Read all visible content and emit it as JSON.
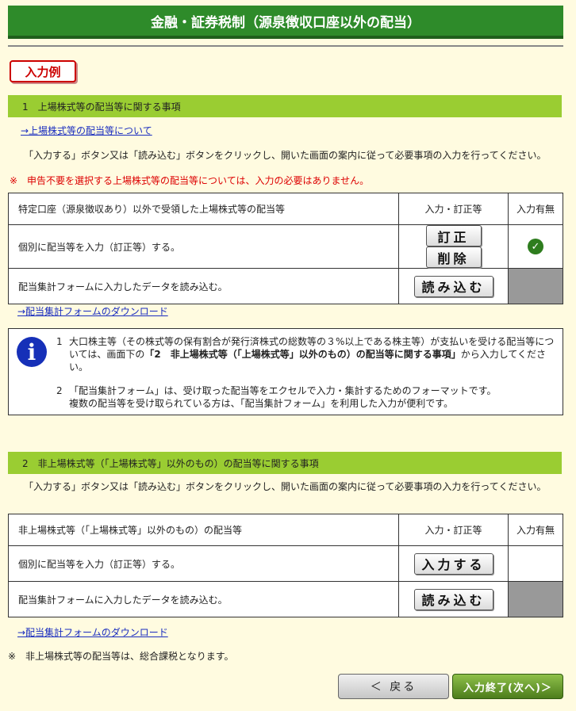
{
  "page_title": "金融・証券税制（源泉徴収口座以外の配当）",
  "example_badge": "入力例",
  "section1": {
    "heading": "1　上場株式等の配当等に関する事項",
    "link_about": "→上場株式等の配当等について",
    "instruction": "「入力する」ボタン又は「読み込む」ボタンをクリックし、開いた画面の案内に従って必要事項の入力を行ってください。",
    "warning": "※　申告不要を選択する上場株式等の配当等については、入力の必要はありません。",
    "table": {
      "header_label": "特定口座（源泉徴収あり）以外で受領した上場株式等の配当等",
      "header_action": "入力・訂正等",
      "header_status": "入力有無",
      "row1_label": "個別に配当等を入力（訂正等）する。",
      "row1_btn_edit": "訂正",
      "row1_btn_delete": "削除",
      "row1_status_icon": "check-icon",
      "row2_label": "配当集計フォームに入力したデータを読み込む。",
      "row2_btn_load": "読み込む"
    },
    "download_link": "→配当集計フォームのダウンロード"
  },
  "info": {
    "icon": "info-icon",
    "item1_num": "1",
    "item1_a": "大口株主等（その株式等の保有割合が発行済株式の総数等の３%以上である株主等）が支払いを受ける配当等については、画面下の",
    "item1_bold": "「2　非上場株式等（「上場株式等」以外のもの）の配当等に関する事項」",
    "item1_b": "から入力してください。",
    "item2_num": "2",
    "item2_a": "「配当集計フォーム」は、受け取った配当等をエクセルで入力・集計するためのフォーマットです。",
    "item2_b": "複数の配当等を受け取られている方は、「配当集計フォーム」を利用した入力が便利です。"
  },
  "section2": {
    "heading": "2　非上場株式等（「上場株式等」以外のもの）の配当等に関する事項",
    "instruction": "「入力する」ボタン又は「読み込む」ボタンをクリックし、開いた画面の案内に従って必要事項の入力を行ってください。",
    "table": {
      "header_label": "非上場株式等（「上場株式等」以外のもの）の配当等",
      "header_action": "入力・訂正等",
      "header_status": "入力有無",
      "row1_label": "個別に配当等を入力（訂正等）する。",
      "row1_btn_input": "入力する",
      "row2_label": "配当集計フォームに入力したデータを読み込む。",
      "row2_btn_load": "読み込む"
    },
    "download_link": "→配当集計フォームのダウンロード"
  },
  "note": "※　非上場株式等の配当等は、総合課税となります。",
  "nav": {
    "back": "＜ 戻る",
    "next": "入力終了(次へ)＞"
  }
}
